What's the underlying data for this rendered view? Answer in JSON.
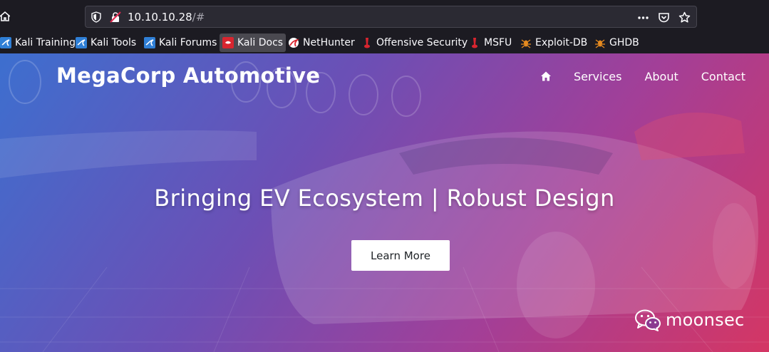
{
  "browser": {
    "url_host": "10.10.10.28",
    "url_path": "/#",
    "bookmarks": [
      {
        "label": "Kali Training",
        "icon": "kali-dragon-icon"
      },
      {
        "label": "Kali Tools",
        "icon": "kali-dragon-icon"
      },
      {
        "label": "Kali Forums",
        "icon": "kali-dragon-icon"
      },
      {
        "label": "Kali Docs",
        "icon": "kali-docs-icon"
      },
      {
        "label": "NetHunter",
        "icon": "nethunter-icon"
      },
      {
        "label": "Offensive Security",
        "icon": "offsec-icon"
      },
      {
        "label": "MSFU",
        "icon": "offsec-icon"
      },
      {
        "label": "Exploit-DB",
        "icon": "exploitdb-bug-icon"
      },
      {
        "label": "GHDB",
        "icon": "exploitdb-bug-icon"
      }
    ]
  },
  "site": {
    "brand": "MegaCorp Automotive",
    "nav": {
      "home_icon": "home-icon",
      "services": "Services",
      "about": "About",
      "contact": "Contact"
    },
    "hero": {
      "title": "Bringing EV Ecosystem | Robust Design",
      "cta": "Learn More"
    }
  },
  "watermark": {
    "text": "moonsec",
    "icon": "wechat-icon"
  },
  "colors": {
    "chrome_bg": "#1c1b22",
    "urlbar_bg": "#2b2a33",
    "gradient_start": "#3d6fcf",
    "gradient_mid": "#a23f98",
    "gradient_end": "#d43664"
  }
}
